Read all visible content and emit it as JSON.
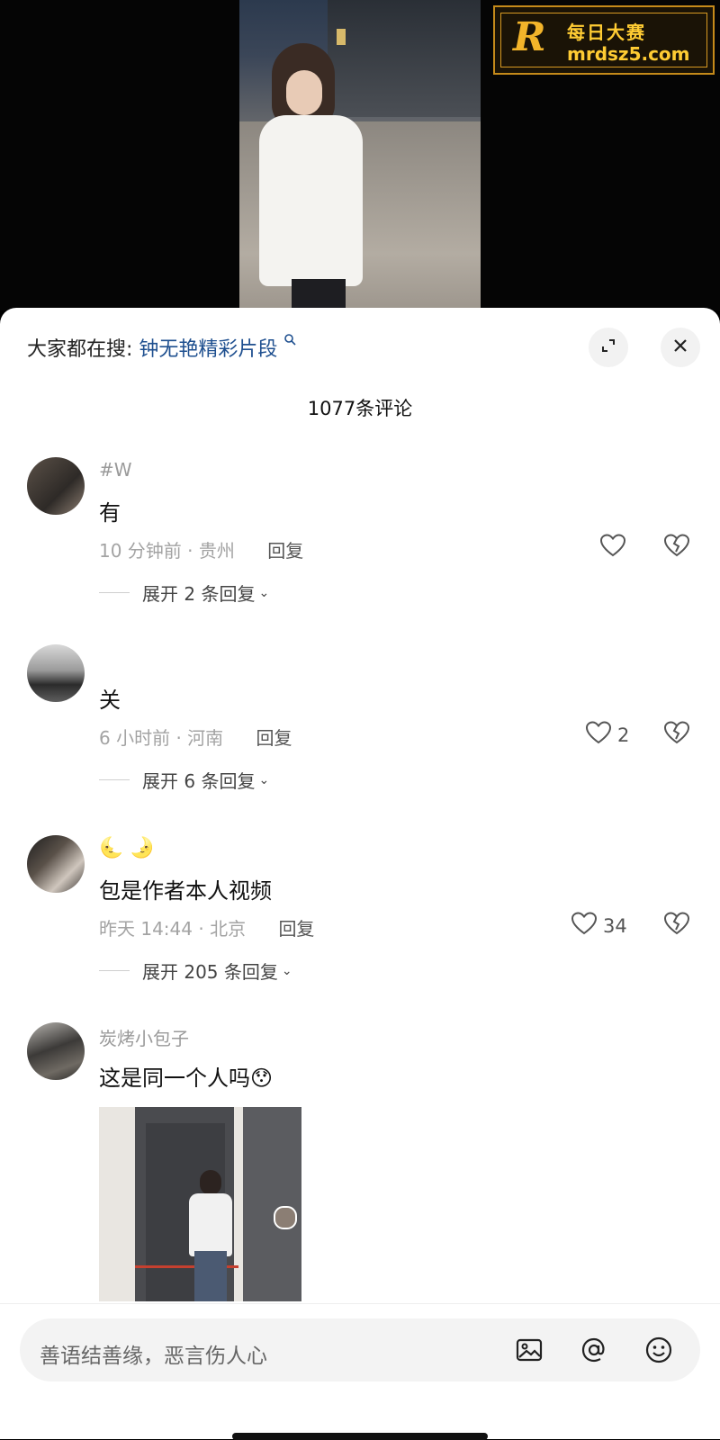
{
  "watermark": {
    "logo_letter": "R",
    "cn_text": "每日大赛",
    "url": "mrdsz5.com"
  },
  "sheet": {
    "search_prefix": "大家都在搜:",
    "search_term": "钟无艳精彩片段",
    "comment_count": "1077条评论"
  },
  "comments": [
    {
      "username": "#W",
      "content": "有",
      "time_location": "10 分钟前 · 贵州",
      "reply_label": "回复",
      "like_count": "",
      "expand_label": "展开 2 条回复"
    },
    {
      "username": "",
      "content": "关",
      "time_location": "6 小时前 · 河南",
      "reply_label": "回复",
      "like_count": "2",
      "expand_label": "展开 6 条回复"
    },
    {
      "username": "🌜 🌛",
      "content": "包是作者本人视频",
      "time_location": "昨天 14:44 · 北京",
      "reply_label": "回复",
      "like_count": "34",
      "expand_label": "展开 205 条回复"
    },
    {
      "username": "炭烤小包子",
      "content": "这是同一个人吗😯",
      "time_location": "",
      "reply_label": "",
      "like_count": "",
      "expand_label": ""
    }
  ],
  "input": {
    "placeholder": "善语结善缘，恶言伤人心"
  },
  "icons": {
    "expand": "fullscreen-expand-icon",
    "close": "close-icon",
    "like": "heart-icon",
    "dislike": "broken-heart-icon",
    "image": "image-icon",
    "mention": "at-icon",
    "emoji": "smiley-icon"
  },
  "colors": {
    "search_term": "#1e4f8f",
    "watermark_gold": "#ffcc33"
  }
}
